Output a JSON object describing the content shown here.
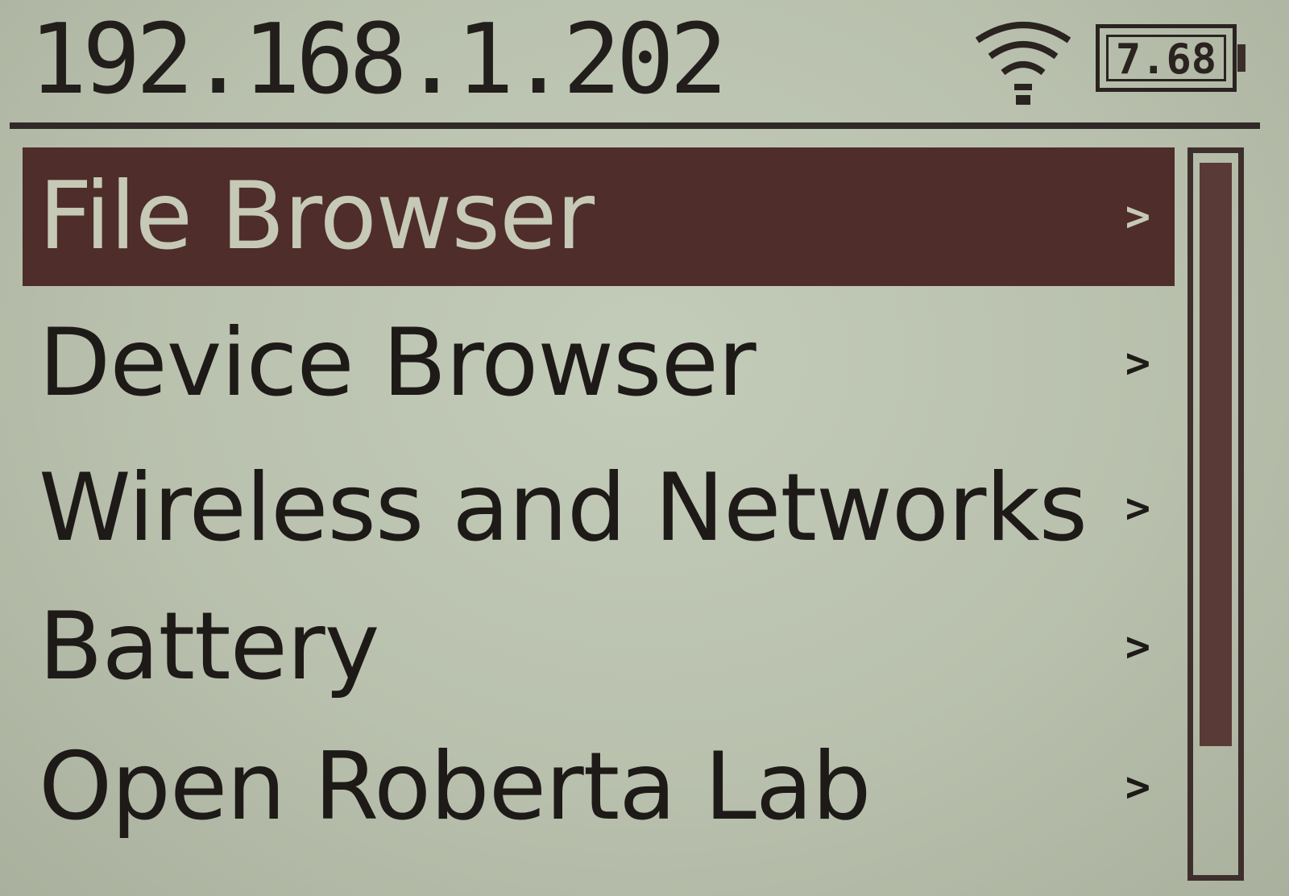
{
  "status": {
    "ip_address": "192.168.1.202",
    "wifi_icon": "wifi-signal-icon",
    "battery_voltage": "7.68",
    "battery_icon": "battery-icon"
  },
  "menu": {
    "selected_index": 0,
    "items": [
      {
        "label": "File Browser",
        "arrow": ">"
      },
      {
        "label": "Device Browser",
        "arrow": ">"
      },
      {
        "label": "Wireless and Networks",
        "arrow": ">"
      },
      {
        "label": "Battery",
        "arrow": ">"
      },
      {
        "label": "Open Roberta Lab",
        "arrow": ">"
      }
    ]
  },
  "scrollbar": {
    "visible_fraction": 0.83,
    "position_fraction": 0.0
  },
  "colors": {
    "screen_background": "#bfc7b4",
    "foreground": "#1d1a17",
    "selection_background": "#4e2d2b",
    "selection_text": "#c6c9b6"
  }
}
